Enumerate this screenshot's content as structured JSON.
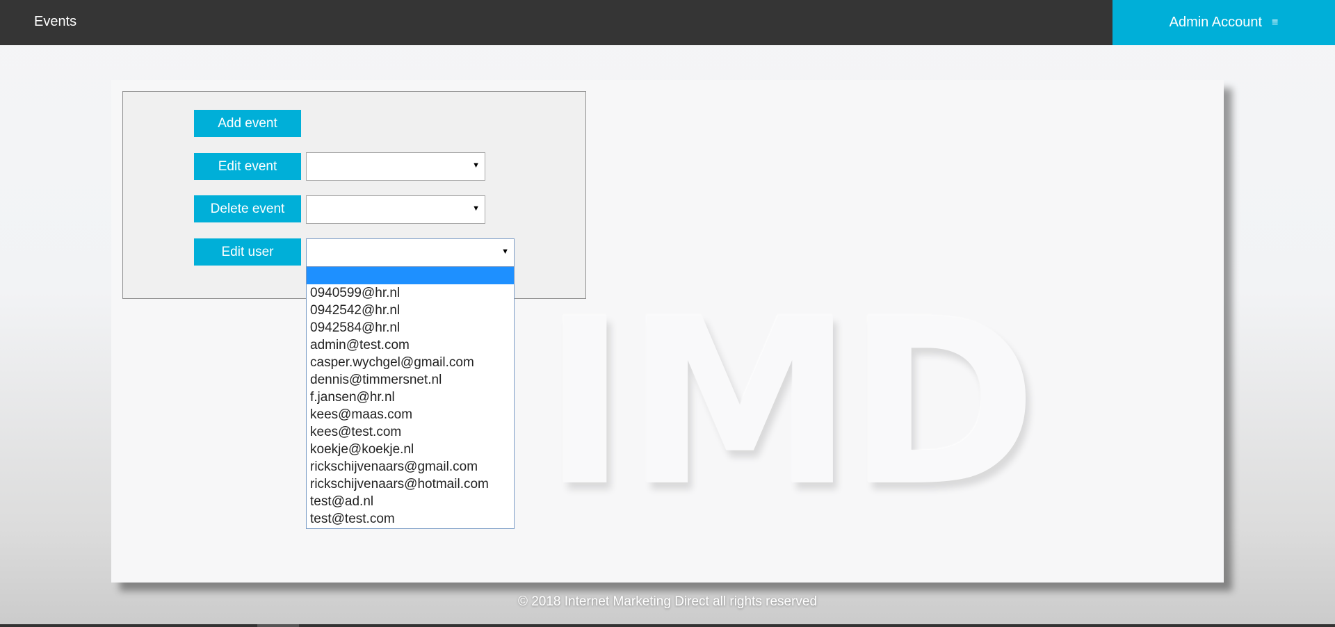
{
  "header": {
    "title": "Events",
    "account_label": "Admin Account",
    "menu_icon": "≡"
  },
  "watermark": {
    "text_i": "I",
    "text_md": "MD"
  },
  "actions": {
    "add_event": "Add event",
    "edit_event": "Edit event",
    "delete_event": "Delete event",
    "edit_user": "Edit user"
  },
  "selects": {
    "edit_event_value": "",
    "delete_event_value": "",
    "edit_user_value": "",
    "arrow": "▼"
  },
  "user_options": [
    "",
    "0940599@hr.nl",
    "0942542@hr.nl",
    "0942584@hr.nl",
    "admin@test.com",
    "casper.wychgel@gmail.com",
    "dennis@timmersnet.nl",
    "f.jansen@hr.nl",
    "kees@maas.com",
    "kees@test.com",
    "koekje@koekje.nl",
    "rickschijvenaars@gmail.com",
    "rickschijvenaars@hotmail.com",
    "test@ad.nl",
    "test@test.com"
  ],
  "footer": {
    "copyright": "© 2018 Internet Marketing Direct all rights reserved"
  },
  "colors": {
    "accent": "#00afd8",
    "topbar": "#353535",
    "selected_option": "#1e90ff"
  }
}
